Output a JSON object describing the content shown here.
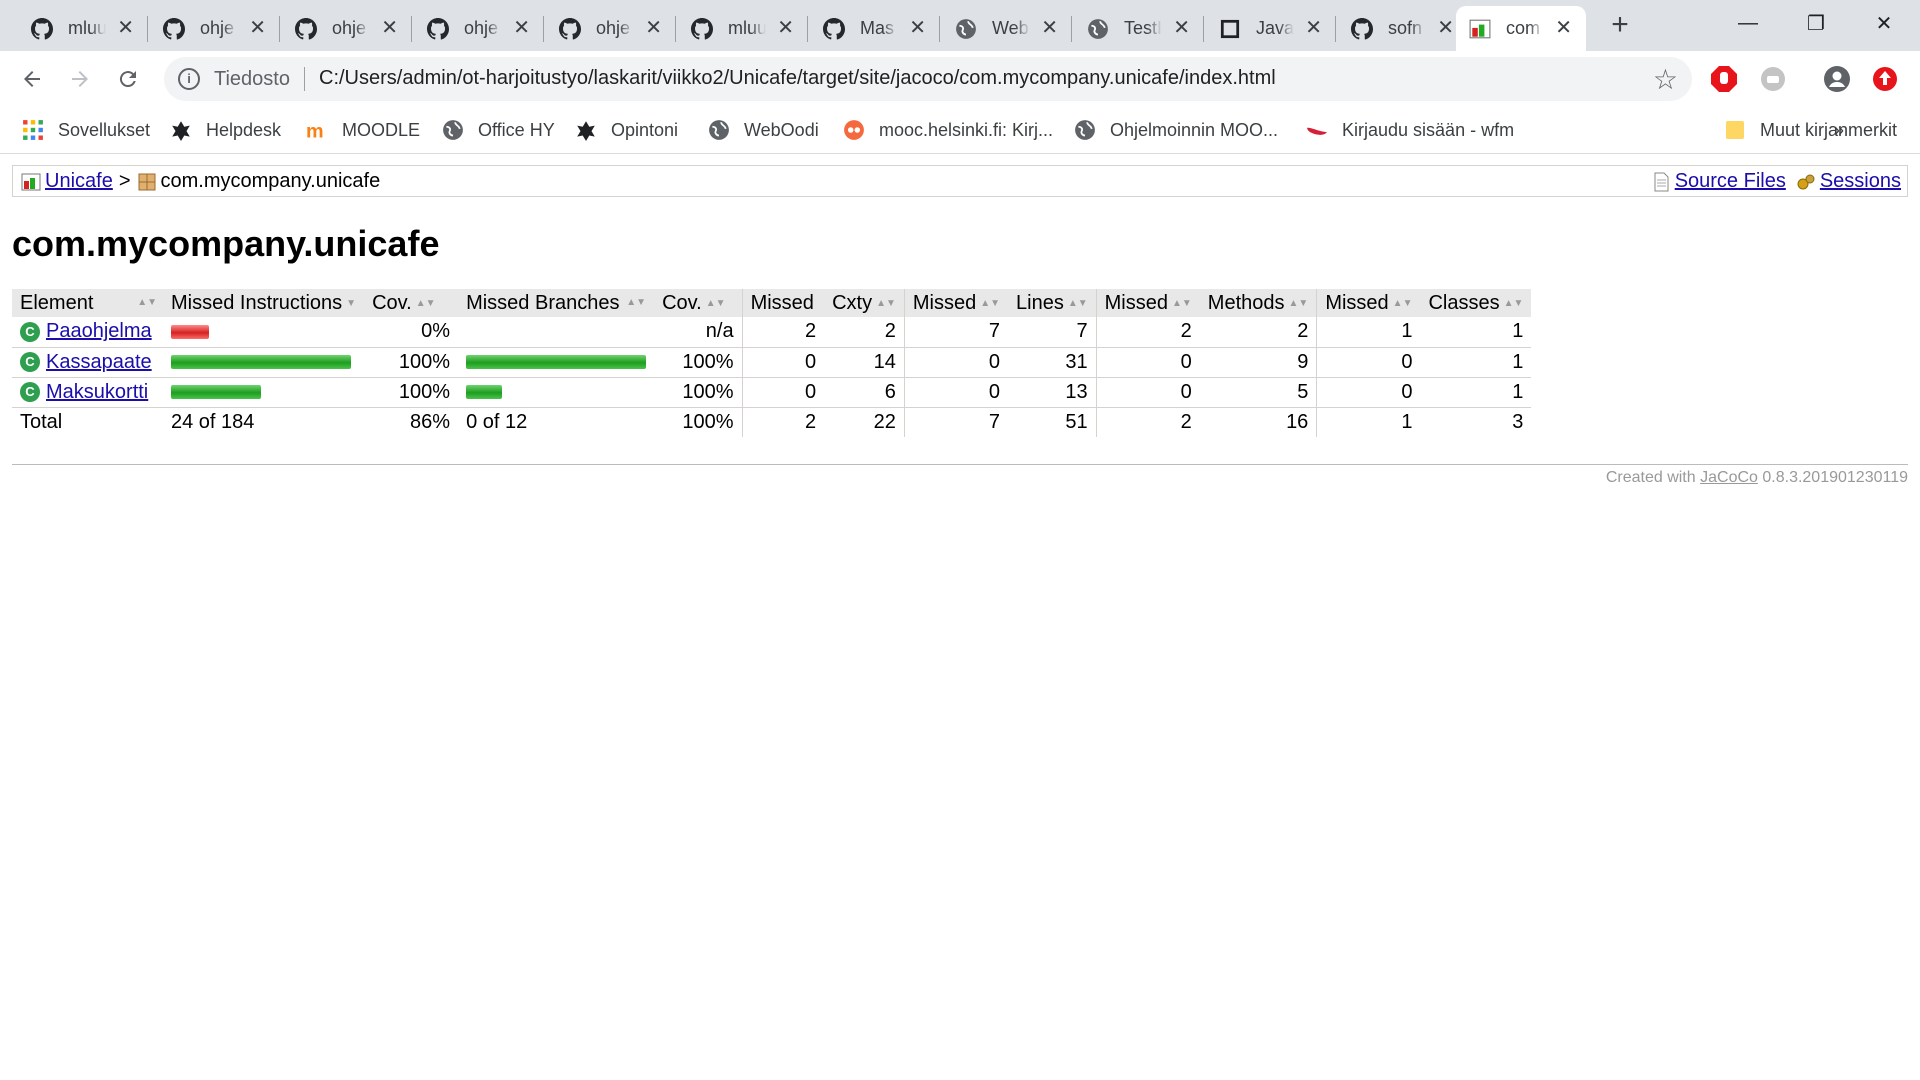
{
  "tabs": [
    {
      "title": "mluu",
      "icon": "github-icon"
    },
    {
      "title": "ohje",
      "icon": "github-icon"
    },
    {
      "title": "ohje",
      "icon": "github-icon"
    },
    {
      "title": "ohje",
      "icon": "github-icon"
    },
    {
      "title": "ohje",
      "icon": "github-icon"
    },
    {
      "title": "mluu",
      "icon": "github-icon"
    },
    {
      "title": "Mas",
      "icon": "github-icon"
    },
    {
      "title": "Web",
      "icon": "globe-icon"
    },
    {
      "title": "TestI",
      "icon": "globe-icon"
    },
    {
      "title": "Java",
      "icon": "square-icon"
    },
    {
      "title": "sofn",
      "icon": "github-icon"
    },
    {
      "title": "com",
      "icon": "jacoco-icon",
      "active": true
    }
  ],
  "toolbar": {
    "secure_label": "Tiedosto",
    "url": "C:/Users/admin/ot-harjoitustyo/laskarit/viikko2/Unicafe/target/site/jacoco/com.mycompany.unicafe/index.html"
  },
  "bookmarks": {
    "items": [
      {
        "label": "Sovellukset",
        "icon": "apps-grid-icon"
      },
      {
        "label": "Helpdesk",
        "icon": "hy-logo-icon"
      },
      {
        "label": "MOODLE",
        "icon": "moodle-icon"
      },
      {
        "label": "Office HY",
        "icon": "globe-icon"
      },
      {
        "label": "Opintoni",
        "icon": "hy-logo-icon"
      },
      {
        "label": "WebOodi",
        "icon": "globe-icon"
      },
      {
        "label": "mooc.helsinki.fi: Kirj...",
        "icon": "mooc-icon"
      },
      {
        "label": "Ohjelmoinnin MOO...",
        "icon": "globe-icon"
      },
      {
        "label": "Kirjaudu sisään - wfm",
        "icon": "wfm-icon"
      }
    ],
    "overflow": "»",
    "other_label": "Muut kirjanmerkit"
  },
  "breadcrumb": {
    "root": "Unicafe",
    "separator": ">",
    "current": "com.mycompany.unicafe",
    "source_files": "Source Files",
    "sessions": "Sessions"
  },
  "page_title": "com.mycompany.unicafe",
  "table": {
    "headers": [
      "Element",
      "Missed Instructions",
      "Cov.",
      "Missed Branches",
      "Cov.",
      "Missed",
      "Cxty",
      "Missed",
      "Lines",
      "Missed",
      "Methods",
      "Missed",
      "Classes"
    ],
    "rows": [
      {
        "name": "Paaohjelma",
        "instr_bar": {
          "color": "red",
          "fraction": 0.21
        },
        "instr_cov": "0%",
        "branch_bar": null,
        "branch_cov": "n/a",
        "missed_cxty": "2",
        "cxty": "2",
        "missed_lines": "7",
        "lines": "7",
        "missed_methods": "2",
        "methods": "2",
        "missed_classes": "1",
        "classes": "1"
      },
      {
        "name": "Kassapaate",
        "instr_bar": {
          "color": "green",
          "fraction": 1.0
        },
        "instr_cov": "100%",
        "branch_bar": {
          "color": "green",
          "fraction": 1.0
        },
        "branch_cov": "100%",
        "missed_cxty": "0",
        "cxty": "14",
        "missed_lines": "0",
        "lines": "31",
        "missed_methods": "0",
        "methods": "9",
        "missed_classes": "0",
        "classes": "1"
      },
      {
        "name": "Maksukortti",
        "instr_bar": {
          "color": "green",
          "fraction": 0.5
        },
        "instr_cov": "100%",
        "branch_bar": {
          "color": "green",
          "fraction": 0.2
        },
        "branch_cov": "100%",
        "missed_cxty": "0",
        "cxty": "6",
        "missed_lines": "0",
        "lines": "13",
        "missed_methods": "0",
        "methods": "5",
        "missed_classes": "0",
        "classes": "1"
      }
    ],
    "total": {
      "label": "Total",
      "instr": "24 of 184",
      "instr_cov": "86%",
      "branch": "0 of 12",
      "branch_cov": "100%",
      "missed_cxty": "2",
      "cxty": "22",
      "missed_lines": "7",
      "lines": "51",
      "missed_methods": "2",
      "methods": "16",
      "missed_classes": "1",
      "classes": "3"
    }
  },
  "footer": {
    "prefix": "Created with",
    "link": "JaCoCo",
    "version": "0.8.3.201901230119"
  },
  "colors": {
    "link": "#1a0dab",
    "covered": "#22aa22",
    "missed": "#dd2222"
  }
}
